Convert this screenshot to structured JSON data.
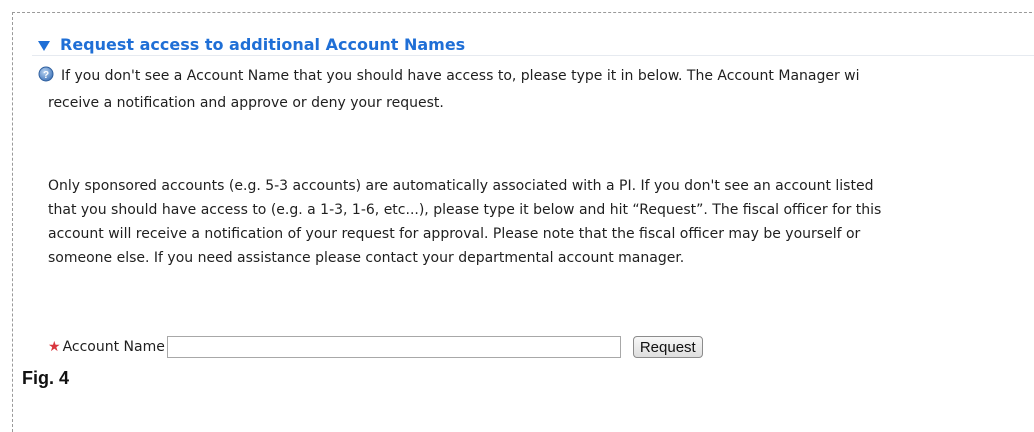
{
  "section": {
    "title": "Request access to additional Account Names",
    "help_line_1": "If you don't see a Account Name that you should have access to, please type it in below. The Account Manager wi",
    "help_line_2": "receive a notification and approve or deny your request."
  },
  "info": {
    "lines": [
      "Only sponsored accounts (e.g. 5-3 accounts) are automatically associated with a PI. If you don't see an account listed",
      "that you should have access to (e.g. a 1-3, 1-6, etc...), please type it below and hit “Request”. The fiscal officer for this",
      "account will receive a notification of your request for approval. Please note that the fiscal officer may be yourself or",
      "someone else. If you need assistance please contact your departmental account manager."
    ]
  },
  "form": {
    "required_marker": "★",
    "label": "Account Name",
    "input_value": "",
    "button_label": "Request"
  },
  "caption": "Fig. 4",
  "colors": {
    "accent": "#1f6fd6",
    "required": "#d9363e"
  },
  "icons": {
    "toggle": "triangle-down-icon",
    "help": "help-question-icon",
    "required": "required-star-icon"
  }
}
